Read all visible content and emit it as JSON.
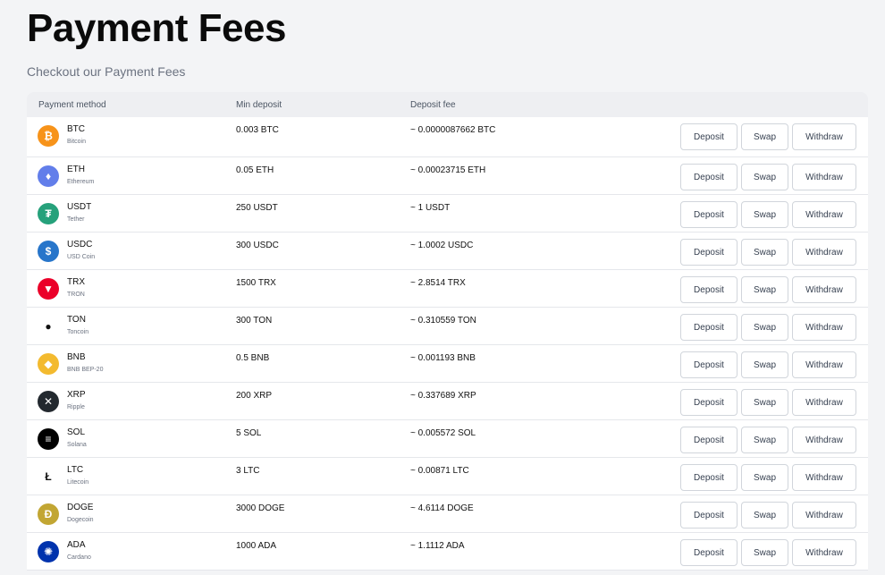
{
  "header": {
    "title": "Payment Fees",
    "subtitle": "Checkout our Payment Fees"
  },
  "table": {
    "columns": [
      "Payment method",
      "Min deposit",
      "Deposit fee"
    ],
    "actions": {
      "deposit": "Deposit",
      "swap": "Swap",
      "withdraw": "Withdraw"
    },
    "rows": [
      {
        "symbol": "BTC",
        "name": "Bitcoin",
        "min_deposit": "0.003 BTC",
        "deposit_fee": "~ 0.0000087662 BTC",
        "icon": "bitcoin-icon",
        "color": "#f7931a",
        "glyph": "₿"
      },
      {
        "symbol": "ETH",
        "name": "Ethereum",
        "min_deposit": "0.05 ETH",
        "deposit_fee": "~ 0.00023715 ETH",
        "icon": "ethereum-icon",
        "color": "#627eea",
        "glyph": "♦"
      },
      {
        "symbol": "USDT",
        "name": "Tether",
        "min_deposit": "250 USDT",
        "deposit_fee": "~ 1 USDT",
        "icon": "tether-icon",
        "color": "#26a17b",
        "glyph": "₮"
      },
      {
        "symbol": "USDC",
        "name": "USD Coin",
        "min_deposit": "300 USDC",
        "deposit_fee": "~ 1.0002 USDC",
        "icon": "usd-coin-icon",
        "color": "#2775ca",
        "glyph": "$"
      },
      {
        "symbol": "TRX",
        "name": "TRON",
        "min_deposit": "1500 TRX",
        "deposit_fee": "~ 2.8514 TRX",
        "icon": "tron-icon",
        "color": "#eb0029",
        "glyph": "▼"
      },
      {
        "symbol": "TON",
        "name": "Toncoin",
        "min_deposit": "300 TON",
        "deposit_fee": "~ 0.310559 TON",
        "icon": "toncoin-icon",
        "color": "#ffffff",
        "glyph": "●"
      },
      {
        "symbol": "BNB",
        "name": "BNB BEP-20",
        "min_deposit": "0.5 BNB",
        "deposit_fee": "~ 0.001193 BNB",
        "icon": "bnb-icon",
        "color": "#f3ba2f",
        "glyph": "◆"
      },
      {
        "symbol": "XRP",
        "name": "Ripple",
        "min_deposit": "200 XRP",
        "deposit_fee": "~ 0.337689 XRP",
        "icon": "xrp-icon",
        "color": "#23292f",
        "glyph": "✕"
      },
      {
        "symbol": "SOL",
        "name": "Solana",
        "min_deposit": "5 SOL",
        "deposit_fee": "~ 0.005572 SOL",
        "icon": "solana-icon",
        "color": "#000000",
        "glyph": "≡"
      },
      {
        "symbol": "LTC",
        "name": "Litecoin",
        "min_deposit": "3 LTC",
        "deposit_fee": "~ 0.00871 LTC",
        "icon": "litecoin-icon",
        "color": "#ffffff",
        "glyph": "Ł"
      },
      {
        "symbol": "DOGE",
        "name": "Dogecoin",
        "min_deposit": "3000 DOGE",
        "deposit_fee": "~ 4.6114 DOGE",
        "icon": "dogecoin-icon",
        "color": "#c2a633",
        "glyph": "Ð"
      },
      {
        "symbol": "ADA",
        "name": "Cardano",
        "min_deposit": "1000 ADA",
        "deposit_fee": "~ 1.1112 ADA",
        "icon": "cardano-icon",
        "color": "#0033ad",
        "glyph": "✺"
      }
    ]
  }
}
